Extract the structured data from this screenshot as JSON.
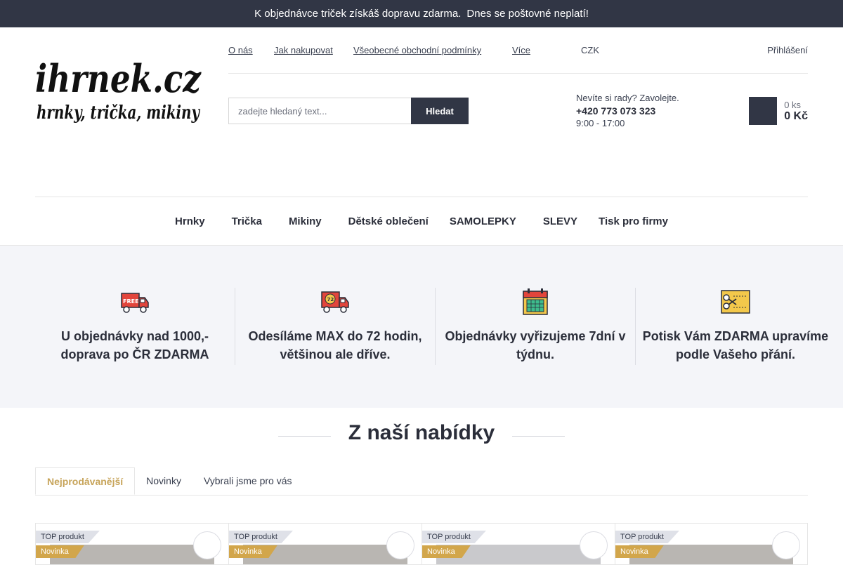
{
  "announcement": {
    "icon_left": "",
    "text": "K objednávce triček získáš dopravu zdarma.",
    "icon_mid": "",
    "text2": "Dnes se poštovné neplatí!",
    "icon_right": "",
    "close": ""
  },
  "logo": {
    "line1": "ihrnek.cz",
    "line2": "hrnky, trička, mikiny"
  },
  "toplinks": {
    "about": "O nás",
    "how_to_buy": "Jak nakupovat",
    "terms": "Všeobecné obchodní podmínky",
    "more_icon": "",
    "more": "Více",
    "currency_icon": "",
    "currency": "CZK",
    "currency_chev": "",
    "login_icon1": "",
    "login_icon2": "",
    "login": "Přihlášení"
  },
  "search": {
    "placeholder": "zadejte hledaný text...",
    "button": "Hledat"
  },
  "contact": {
    "icon": "",
    "prompt": "Nevíte si rady? Zavolejte.",
    "phone": "+420 773 073 323",
    "hours": "9:00 - 17:00"
  },
  "cart": {
    "icon": "",
    "qty": "0 ks",
    "sum": "0 Kč"
  },
  "nav": [
    {
      "label": "Hrnky",
      "chev": ""
    },
    {
      "label": "Trička",
      "chev": ""
    },
    {
      "label": "Mikiny",
      "chev": ""
    },
    {
      "label": "Dětské oblečení",
      "chev": ""
    },
    {
      "label": "SAMOLEPKY",
      "chev": ""
    },
    {
      "label": "SLEVY",
      "chev": ""
    },
    {
      "label": "Tisk pro firmy",
      "chev": ""
    }
  ],
  "benefits": [
    {
      "icon": "free-delivery-truck-icon",
      "icon_text": "FREE",
      "text": "U objednávky nad 1000,- doprava po ČR ZDARMA"
    },
    {
      "icon": "72h-delivery-truck-icon",
      "icon_text": "72",
      "text": "Odesíláme MAX do 72 hodin, většinou ale dříve."
    },
    {
      "icon": "calendar-icon",
      "text": "Objednávky vyřizujeme 7dní v týdnu."
    },
    {
      "icon": "coupon-scissors-icon",
      "text": "Potisk Vám ZDARMA upravíme podle Vašeho přání."
    }
  ],
  "offer": {
    "title": "Z naší nabídky"
  },
  "tabs": [
    "Nejprodávanější",
    "Novinky",
    "Vybrali jsme pro vás"
  ],
  "products": [
    {
      "flag_top": "TOP produkt",
      "flag_new": "Novinka",
      "fav": ""
    },
    {
      "flag_top": "TOP produkt",
      "flag_new": "Novinka",
      "fav": ""
    },
    {
      "flag_top": "TOP produkt",
      "flag_new": "Novinka",
      "fav": ""
    },
    {
      "flag_top": "TOP produkt",
      "flag_new": "Novinka",
      "fav": ""
    }
  ],
  "colors": {
    "dark": "#313645",
    "accent": "#c7a45a",
    "truck_red": "#e2453c",
    "benefits_bg": "#f4f5f9"
  }
}
